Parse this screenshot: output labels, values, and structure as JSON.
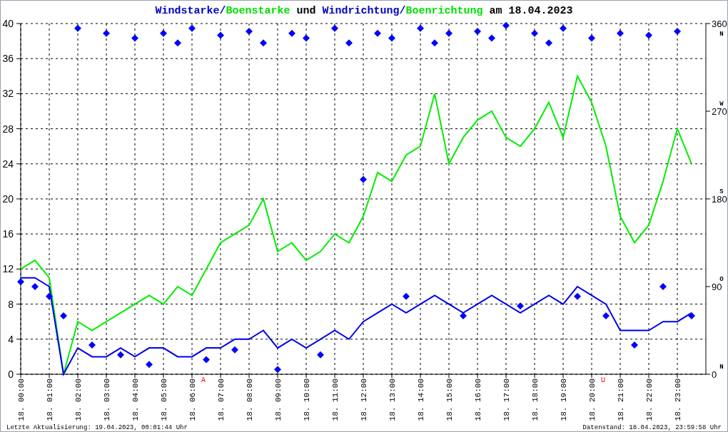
{
  "title": [
    {
      "text": "Windstarke",
      "color": "#0000c0"
    },
    {
      "text": "/",
      "color": "#0000c0"
    },
    {
      "text": "Boenstarke",
      "color": "#00e000"
    },
    {
      "text": " und ",
      "color": "#000000"
    },
    {
      "text": "Windrichtung",
      "color": "#0000c0"
    },
    {
      "text": "/",
      "color": "#0000c0"
    },
    {
      "text": "Boenrichtung",
      "color": "#00e000"
    },
    {
      "text": " am 18.04.2023",
      "color": "#000000"
    }
  ],
  "chart_data": {
    "type": "line",
    "grid": true,
    "categories": [
      "18. 00:00",
      null,
      "18. 01:00",
      null,
      "18. 02:00",
      null,
      "18. 03:00",
      null,
      "18. 04:00",
      null,
      "18. 05:00",
      null,
      "18. 06:00",
      null,
      "18. 07:00",
      null,
      "18. 08:00",
      null,
      "18. 09:00",
      null,
      "18. 10:00",
      null,
      "18. 11:00",
      null,
      "18. 12:00",
      null,
      "18. 13:00",
      null,
      "18. 14:00",
      null,
      "18. 15:00",
      null,
      "18. 16:00",
      null,
      "18. 17:00",
      null,
      "18. 18:00",
      null,
      "18. 19:00",
      null,
      "18. 20:00",
      null,
      "18. 21:00",
      null,
      "18. 22:00",
      null,
      "18. 23:00",
      null
    ],
    "ylim": [
      0,
      40
    ],
    "yticks": [
      0,
      4,
      8,
      12,
      16,
      20,
      24,
      28,
      32,
      36,
      40
    ],
    "series": [
      {
        "color": "#00ee00",
        "values": [
          12,
          13,
          11,
          0,
          6,
          5,
          6,
          7,
          8,
          9,
          8,
          10,
          9,
          12,
          15,
          16,
          17,
          20,
          14,
          15,
          13,
          14,
          16,
          15,
          18,
          23,
          22,
          25,
          26,
          32,
          24,
          27,
          29,
          30,
          27,
          26,
          28,
          31,
          27,
          34,
          31,
          26,
          18,
          15,
          17,
          22,
          28,
          24
        ]
      },
      {
        "color": "#0000ee",
        "values": [
          11,
          11,
          10,
          0,
          3,
          2,
          2,
          3,
          2,
          3,
          3,
          2,
          2,
          3,
          3,
          4,
          4,
          5,
          3,
          4,
          3,
          4,
          5,
          4,
          6,
          7,
          8,
          7,
          8,
          9,
          8,
          7,
          8,
          9,
          8,
          7,
          8,
          9,
          8,
          10,
          9,
          8,
          5,
          5,
          5,
          6,
          6,
          7
        ]
      }
    ]
  },
  "direction_chart": {
    "chart_data": {
      "type": "scatter",
      "categories": [
        null,
        null,
        null,
        null,
        null,
        null,
        null,
        null,
        null,
        null,
        null,
        null,
        null,
        null,
        null,
        null,
        null,
        null,
        null,
        null,
        null,
        null,
        null,
        null,
        null,
        null,
        null,
        null,
        null,
        null,
        null,
        null,
        null,
        null,
        null,
        null,
        null,
        null,
        null,
        null,
        null,
        null,
        null,
        null,
        null,
        null,
        null,
        null
      ],
      "ylim": [
        0,
        360
      ],
      "yticks": [
        0,
        90,
        180,
        270,
        360
      ],
      "series": [
        {
          "color": "#0000ff",
          "values": [
            95,
            90,
            80,
            60,
            355,
            30,
            350,
            20,
            345,
            10,
            350,
            340,
            355,
            15,
            348,
            25,
            352,
            340,
            5,
            350,
            345,
            20,
            355,
            340,
            200,
            350,
            345,
            80,
            355,
            340,
            350,
            60,
            352,
            345,
            358,
            70,
            350,
            340,
            355,
            80,
            345,
            60,
            350,
            30,
            348,
            90,
            352,
            60
          ]
        }
      ]
    }
  },
  "compass": [
    "N",
    "W",
    "S",
    "O",
    "N"
  ],
  "markers": [
    {
      "text": "A"
    },
    {
      "text": "U"
    }
  ],
  "footer": {
    "updated": "Letzte Aktualisierung: 19.04.2023, 00:01:44 Uhr",
    "data_time": "Datenstand: 18.04.2023, 23:59:58 Uhr"
  }
}
